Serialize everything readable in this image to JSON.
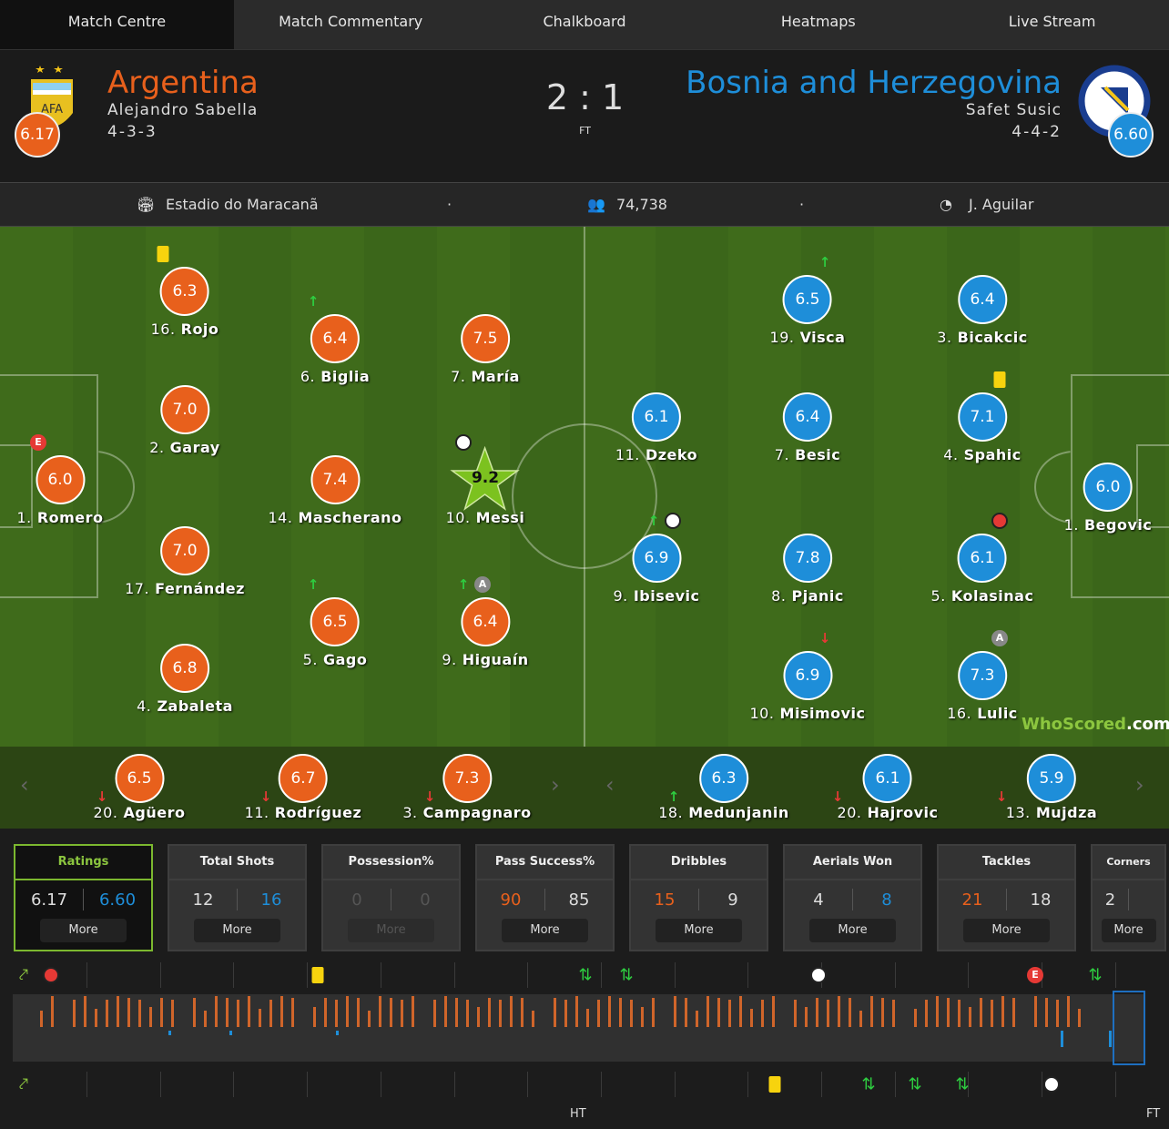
{
  "nav": [
    "Match Centre",
    "Match Commentary",
    "Chalkboard",
    "Heatmaps",
    "Live Stream"
  ],
  "home": {
    "name": "Argentina",
    "coach": "Alejandro Sabella",
    "formation": "4-3-3",
    "rating": "6.17",
    "color": "#e8601c",
    "crest": "AFA"
  },
  "away": {
    "name": "Bosnia and Herzegovina",
    "coach": "Safet Susic",
    "formation": "4-4-2",
    "rating": "6.60",
    "color": "#1e8ed9"
  },
  "score": "2 : 1",
  "status": "FT",
  "info": {
    "venue": "Estadio do Maracanã",
    "attendance": "74,738",
    "referee": "J. Aguilar",
    "venue_icon": "stadium-icon",
    "attendance_icon": "crowd-icon",
    "referee_icon": "whistle-icon"
  },
  "home_players": [
    {
      "num": "16.",
      "name": "Rojo",
      "rating": "6.3",
      "events": [
        "yellow-card"
      ]
    },
    {
      "num": "6.",
      "name": "Biglia",
      "rating": "6.4",
      "events": [
        "sub-in"
      ]
    },
    {
      "num": "7.",
      "name": "María",
      "rating": "7.5",
      "events": []
    },
    {
      "num": "2.",
      "name": "Garay",
      "rating": "7.0",
      "events": []
    },
    {
      "num": "1.",
      "name": "Romero",
      "rating": "6.0",
      "events": [
        "error"
      ]
    },
    {
      "num": "14.",
      "name": "Mascherano",
      "rating": "7.4",
      "events": []
    },
    {
      "num": "10.",
      "name": "Messi",
      "rating": "9.2",
      "events": [
        "goal",
        "man-of-the-match"
      ]
    },
    {
      "num": "17.",
      "name": "Fernández",
      "rating": "7.0",
      "events": []
    },
    {
      "num": "5.",
      "name": "Gago",
      "rating": "6.5",
      "events": [
        "sub-in"
      ]
    },
    {
      "num": "9.",
      "name": "Higuaín",
      "rating": "6.4",
      "events": [
        "sub-in",
        "assist"
      ]
    },
    {
      "num": "4.",
      "name": "Zabaleta",
      "rating": "6.8",
      "events": []
    }
  ],
  "away_players": [
    {
      "num": "19.",
      "name": "Visca",
      "rating": "6.5",
      "events": [
        "sub-in"
      ]
    },
    {
      "num": "3.",
      "name": "Bicakcic",
      "rating": "6.4",
      "events": []
    },
    {
      "num": "11.",
      "name": "Dzeko",
      "rating": "6.1",
      "events": []
    },
    {
      "num": "7.",
      "name": "Besic",
      "rating": "6.4",
      "events": []
    },
    {
      "num": "4.",
      "name": "Spahic",
      "rating": "7.1",
      "events": [
        "yellow-card"
      ]
    },
    {
      "num": "1.",
      "name": "Begovic",
      "rating": "6.0",
      "events": []
    },
    {
      "num": "9.",
      "name": "Ibisevic",
      "rating": "6.9",
      "events": [
        "sub-in",
        "goal"
      ]
    },
    {
      "num": "8.",
      "name": "Pjanic",
      "rating": "7.8",
      "events": []
    },
    {
      "num": "5.",
      "name": "Kolasinac",
      "rating": "6.1",
      "events": [
        "own-goal"
      ]
    },
    {
      "num": "10.",
      "name": "Misimovic",
      "rating": "6.9",
      "events": [
        "sub-out"
      ]
    },
    {
      "num": "16.",
      "name": "Lulic",
      "rating": "7.3",
      "events": [
        "assist"
      ]
    }
  ],
  "home_subs": [
    {
      "num": "20.",
      "name": "Agüero",
      "rating": "6.5",
      "events": [
        "sub-out"
      ]
    },
    {
      "num": "11.",
      "name": "Rodríguez",
      "rating": "6.7",
      "events": [
        "sub-out"
      ]
    },
    {
      "num": "3.",
      "name": "Campagnaro",
      "rating": "7.3",
      "events": [
        "sub-out"
      ]
    }
  ],
  "away_subs": [
    {
      "num": "18.",
      "name": "Medunjanin",
      "rating": "6.3",
      "events": [
        "sub-in"
      ]
    },
    {
      "num": "20.",
      "name": "Hajrovic",
      "rating": "6.1",
      "events": [
        "sub-out"
      ]
    },
    {
      "num": "13.",
      "name": "Mujdza",
      "rating": "5.9",
      "events": [
        "sub-out"
      ]
    }
  ],
  "watermark": {
    "brand": "WhoScored",
    "suffix": ".com"
  },
  "stats": [
    {
      "title": "Ratings",
      "home": "6.17",
      "away": "6.60",
      "more": "More",
      "hl": "away"
    },
    {
      "title": "Total Shots",
      "home": "12",
      "away": "16",
      "more": "More",
      "hl": "away"
    },
    {
      "title": "Possession%",
      "home": "0",
      "away": "0",
      "more": "More",
      "hl": "none"
    },
    {
      "title": "Pass Success%",
      "home": "90",
      "away": "85",
      "more": "More",
      "hl": "home"
    },
    {
      "title": "Dribbles",
      "home": "15",
      "away": "9",
      "more": "More",
      "hl": "home"
    },
    {
      "title": "Aerials Won",
      "home": "4",
      "away": "8",
      "more": "More",
      "hl": "away"
    },
    {
      "title": "Tackles",
      "home": "21",
      "away": "18",
      "more": "More",
      "hl": "home"
    },
    {
      "title": "Corners",
      "home": "2",
      "away": "",
      "more": "More",
      "hl": "none"
    }
  ],
  "timeline": {
    "ht": "HT",
    "ft": "FT"
  }
}
